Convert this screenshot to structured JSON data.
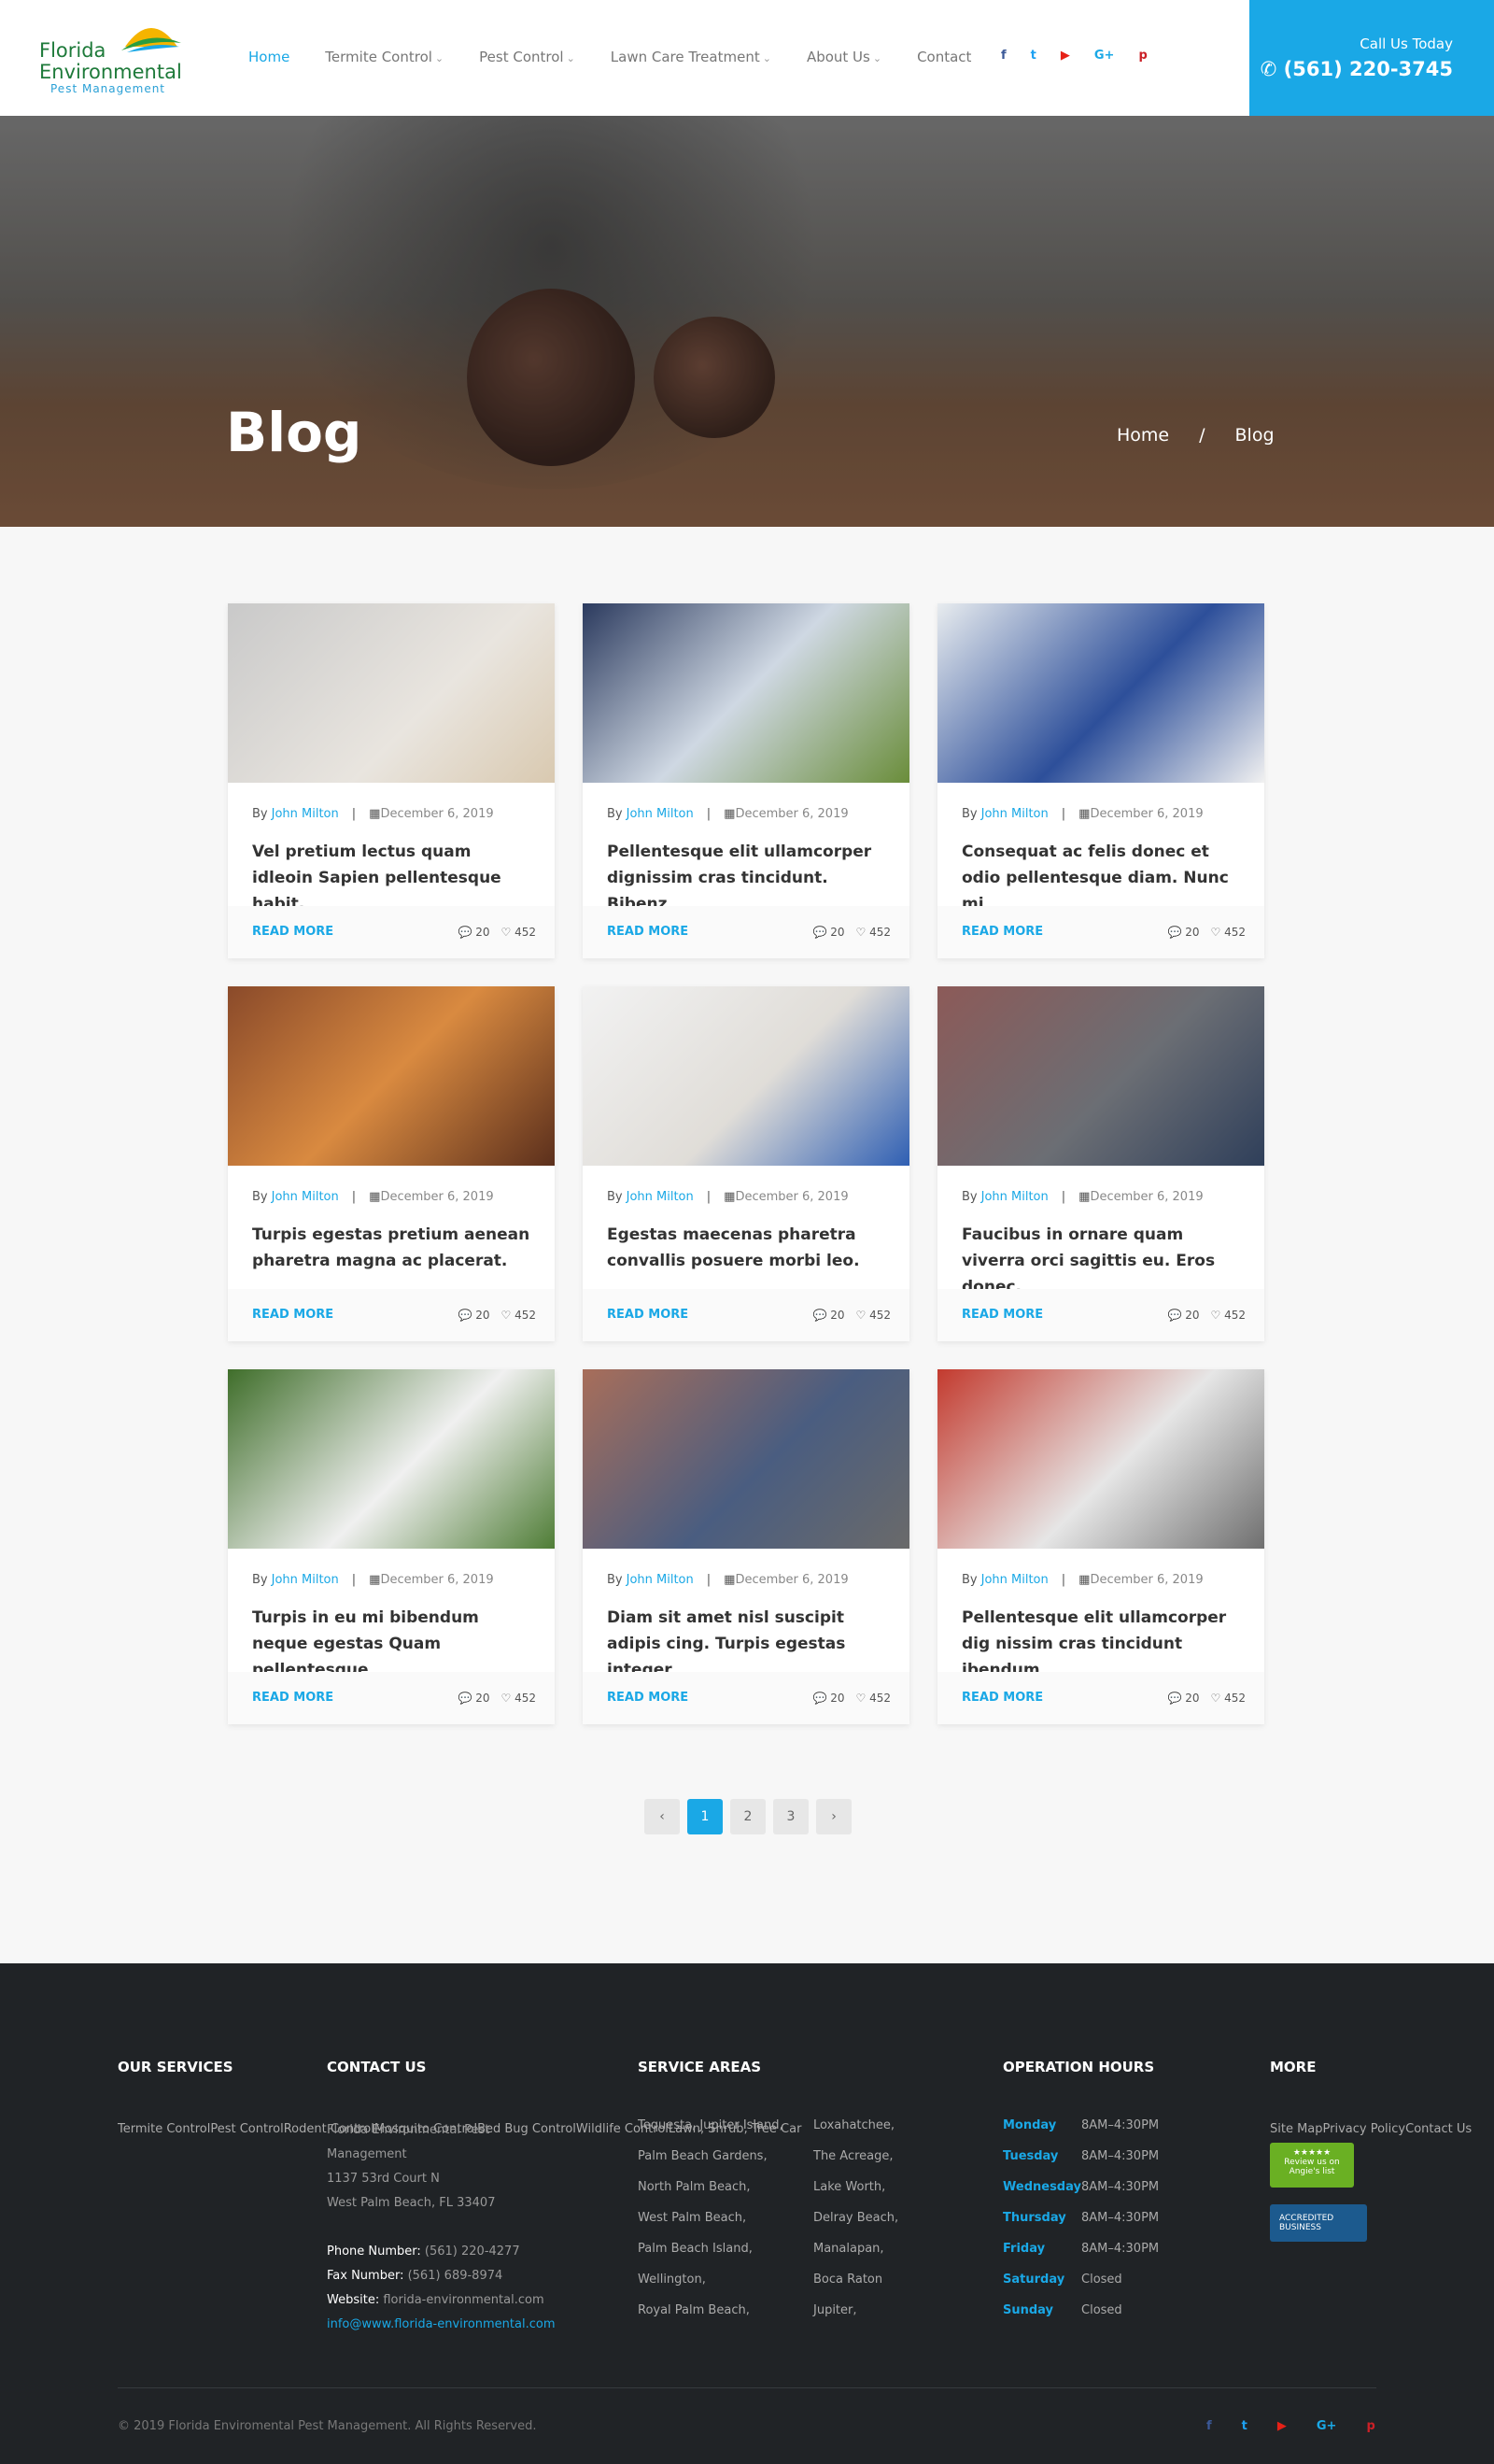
{
  "brand": {
    "line1": "Florida",
    "line2": "Environmental",
    "line3": "Pest Management"
  },
  "nav": {
    "items": [
      {
        "label": "Home",
        "active": true,
        "dropdown": false
      },
      {
        "label": "Termite Control",
        "active": false,
        "dropdown": true
      },
      {
        "label": "Pest Control",
        "active": false,
        "dropdown": true
      },
      {
        "label": "Lawn Care Treatment",
        "active": false,
        "dropdown": true
      },
      {
        "label": "About Us",
        "active": false,
        "dropdown": true
      },
      {
        "label": "Contact",
        "active": false,
        "dropdown": false
      }
    ]
  },
  "social": [
    {
      "icon": "facebook-icon",
      "glyph": "f",
      "color": "#3b5998"
    },
    {
      "icon": "twitter-icon",
      "glyph": "t",
      "color": "#1da1f2"
    },
    {
      "icon": "youtube-icon",
      "glyph": "▶",
      "color": "#e62117"
    },
    {
      "icon": "google-plus-icon",
      "glyph": "G+",
      "color": "#1aa8e6"
    },
    {
      "icon": "pinterest-icon",
      "glyph": "p",
      "color": "#cb2027"
    }
  ],
  "call": {
    "label": "Call Us Today",
    "number": "(561) 220-3745"
  },
  "hero": {
    "title": "Blog",
    "crumb_home": "Home",
    "crumb_sep": "/",
    "crumb_current": "Blog"
  },
  "colors": {
    "accent": "#1aa8e6",
    "footer_bg": "#202326"
  },
  "posts": [
    {
      "author": "John Milton",
      "date": "December 6, 2019",
      "title": "Vel pretium lectus quam idleoin Sapien pellentesque habit.",
      "comments": "20",
      "likes": "452",
      "thumb": "pest-control-sign"
    },
    {
      "author": "John Milton",
      "date": "December 6, 2019",
      "title": "Pellentesque elit ullamcorper dignissim cras tincidunt. Bibenz",
      "comments": "20",
      "likes": "452",
      "thumb": "fogging"
    },
    {
      "author": "John Milton",
      "date": "December 6, 2019",
      "title": "Consequat ac felis donec et odio pellentesque diam. Nunc mi",
      "comments": "20",
      "likes": "452",
      "thumb": "technicians-van"
    },
    {
      "author": "John Milton",
      "date": "December 6, 2019",
      "title": "Turpis egestas pretium aenean pharetra magna ac placerat.",
      "comments": "20",
      "likes": "452",
      "thumb": "termites"
    },
    {
      "author": "John Milton",
      "date": "December 6, 2019",
      "title": "Egestas maecenas pharetra convallis posuere morbi leo.",
      "comments": "20",
      "likes": "452",
      "thumb": "indoor-spray"
    },
    {
      "author": "John Milton",
      "date": "December 6, 2019",
      "title": "Faucibus in ornare quam viverra orci sagittis eu. Eros donec.",
      "comments": "20",
      "likes": "452",
      "thumb": "ants-wall"
    },
    {
      "author": "John Milton",
      "date": "December 6, 2019",
      "title": "Turpis in eu mi bibendum neque egestas Quam pellentesque",
      "comments": "20",
      "likes": "452",
      "thumb": "hazmat-thumbs-up"
    },
    {
      "author": "John Milton",
      "date": "December 6, 2019",
      "title": "Diam sit amet nisl suscipit adipis cing. Turpis egestas integer",
      "comments": "20",
      "likes": "452",
      "thumb": "yard-spray"
    },
    {
      "author": "John Milton",
      "date": "December 6, 2019",
      "title": "Pellentesque elit ullamcorper dig nissim cras tincidunt ibendum",
      "comments": "20",
      "likes": "452",
      "thumb": "van-garage"
    }
  ],
  "labels": {
    "by": "By",
    "read_more": "READ MORE"
  },
  "pagination": {
    "prev": "‹",
    "pages": [
      "1",
      "2",
      "3"
    ],
    "current": "1",
    "next": "›"
  },
  "footer": {
    "services": {
      "heading": "OUR SERVICES",
      "items": [
        "Termite Control",
        "Pest Control",
        "Rodent Control",
        "Mosquito Control",
        "Bed Bug Control",
        "Wildlife Control",
        "Lawn, Shrub, Tree Car"
      ]
    },
    "contact": {
      "heading": "CONTACT US",
      "company": "Florida Environmental Pest Management",
      "street": "1137 53rd Court N",
      "city": "West Palm Beach, FL 33407",
      "phone_label": "Phone Number:",
      "phone": "(561) 220-4277",
      "fax_label": "Fax Number:",
      "fax": "(561) 689-8974",
      "web_label": "Website:",
      "web": "florida-environmental.com",
      "email": "info@www.florida-environmental.com"
    },
    "areas": {
      "heading": "SERVICE AREAS",
      "col1": [
        "Tequesta, Jupiter Island,",
        "Palm Beach Gardens,",
        "North Palm Beach,",
        "West Palm Beach,",
        "Palm Beach Island,",
        "Wellington,",
        "Royal Palm Beach,"
      ],
      "col2": [
        "Loxahatchee,",
        "The Acreage,",
        "Lake Worth,",
        "Delray Beach,",
        "Manalapan,",
        "Boca Raton",
        "Jupiter,"
      ]
    },
    "hours": {
      "heading": "OPERATION HOURS",
      "rows": [
        {
          "day": "Monday",
          "time": "8AM–4:30PM"
        },
        {
          "day": "Tuesday",
          "time": "8AM–4:30PM"
        },
        {
          "day": "Wednesday",
          "time": "8AM–4:30PM"
        },
        {
          "day": "Thursday",
          "time": "8AM–4:30PM"
        },
        {
          "day": "Friday",
          "time": "8AM–4:30PM"
        },
        {
          "day": "Saturday",
          "time": "Closed"
        },
        {
          "day": "Sunday",
          "time": "Closed"
        }
      ]
    },
    "more": {
      "heading": "MORE",
      "items": [
        "Site Map",
        "Privacy Policy",
        "Contact Us"
      ],
      "badge_angies": "Review us on Angie's list",
      "badge_bbb": "ACCREDITED BUSINESS"
    },
    "copyright": "© 2019 Florida Enviromental Pest Management. All Rights Reserved."
  }
}
